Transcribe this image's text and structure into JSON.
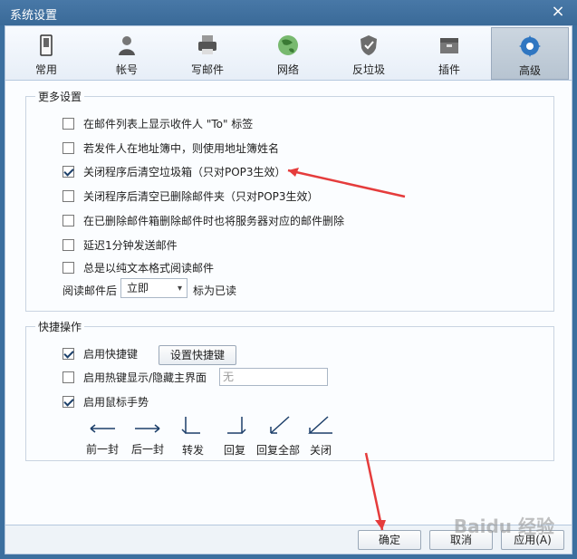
{
  "window": {
    "title": "系统设置",
    "close_icon": "close-icon"
  },
  "toolbar": {
    "items": [
      {
        "label": "常用",
        "icon": "phone-icon"
      },
      {
        "label": "帐号",
        "icon": "user-icon"
      },
      {
        "label": "写邮件",
        "icon": "printer-icon"
      },
      {
        "label": "网络",
        "icon": "globe-icon"
      },
      {
        "label": "反垃圾",
        "icon": "shield-icon"
      },
      {
        "label": "插件",
        "icon": "box-icon"
      },
      {
        "label": "高级",
        "icon": "gear-icon",
        "active": true
      }
    ]
  },
  "more_settings": {
    "title": "更多设置",
    "options": [
      {
        "label": "在邮件列表上显示收件人 \"To\" 标签",
        "checked": false
      },
      {
        "label": "若发件人在地址簿中，则使用地址簿姓名",
        "checked": false
      },
      {
        "label": "关闭程序后清空垃圾箱（只对POP3生效）",
        "checked": true
      },
      {
        "label": "关闭程序后清空已删除邮件夹（只对POP3生效）",
        "checked": false
      },
      {
        "label": "在已删除邮件箱删除邮件时也将服务器对应的邮件删除",
        "checked": false
      },
      {
        "label": "延迟1分钟发送邮件",
        "checked": false
      },
      {
        "label": "总是以纯文本格式阅读邮件",
        "checked": false
      }
    ],
    "read_after_label": "阅读邮件后",
    "read_after_value": "立即",
    "mark_as_read_label": "标为已读"
  },
  "quick_ops": {
    "title": "快捷操作",
    "enable_shortcut": {
      "label": "启用快捷键",
      "checked": true
    },
    "set_shortcut_button": "设置快捷键",
    "hotkey_toggle": {
      "label": "启用热键显示/隐藏主界面",
      "checked": false
    },
    "hotkey_value": "无",
    "mouse_gesture": {
      "label": "启用鼠标手势",
      "checked": true
    },
    "gestures": [
      {
        "label": "前一封",
        "icon": "left-arrow-icon"
      },
      {
        "label": "后一封",
        "icon": "right-arrow-icon"
      },
      {
        "label": "转发",
        "icon": "forward-gesture-icon"
      },
      {
        "label": "回复",
        "icon": "reply-gesture-icon"
      },
      {
        "label": "回复全部",
        "icon": "reply-all-gesture-icon"
      },
      {
        "label": "关闭",
        "icon": "close-gesture-icon"
      }
    ]
  },
  "footer": {
    "ok": "确定",
    "cancel": "取消",
    "apply": "应用(A)"
  },
  "watermark": "Baidu 经验"
}
